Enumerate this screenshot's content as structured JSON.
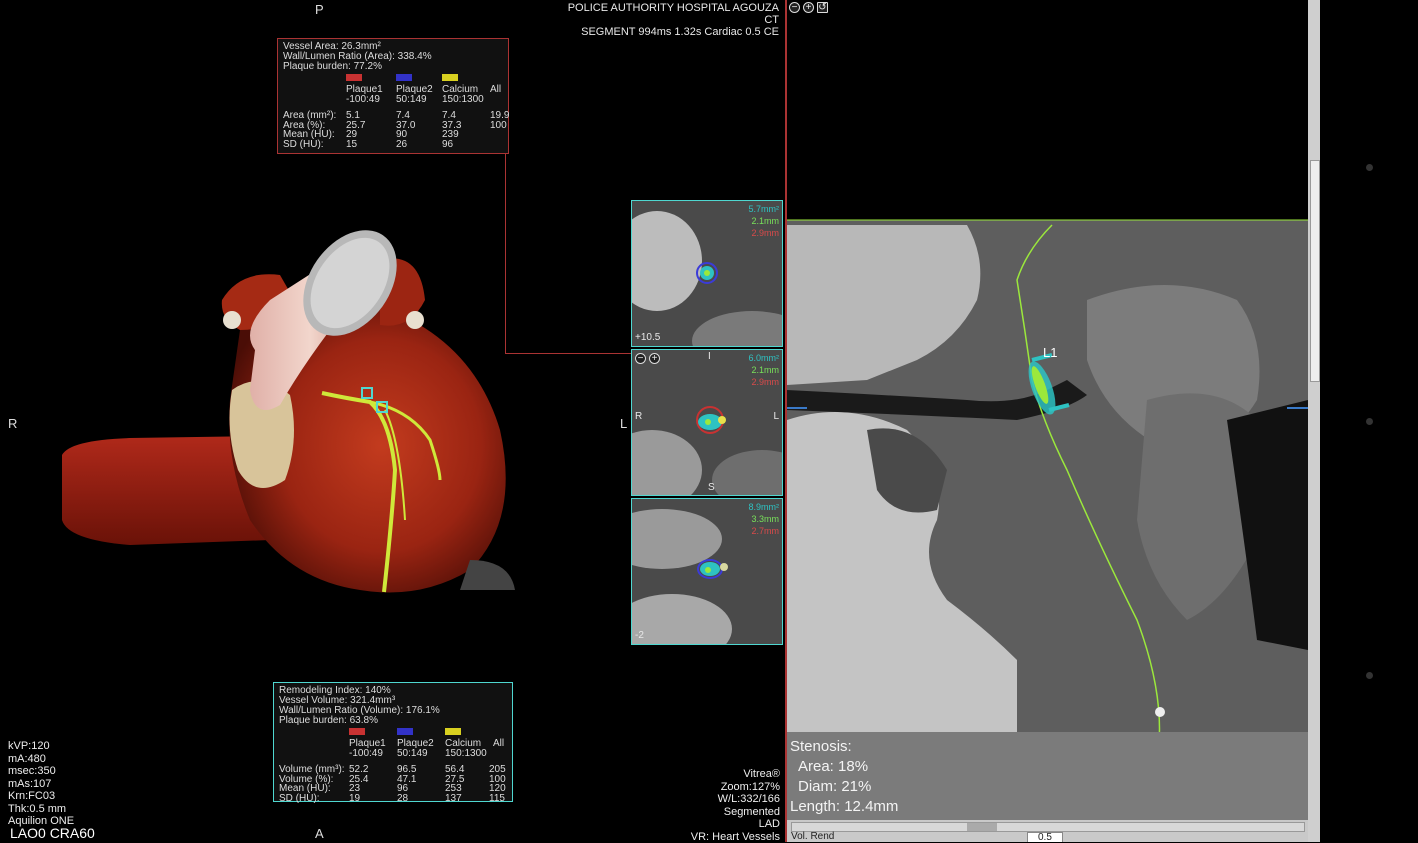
{
  "header": {
    "hospital": "POLICE AUTHORITY HOSPITAL AGOUZA",
    "modality": "CT",
    "segment": "SEGMENT 994ms 1.32s Cardiac 0.5 CE"
  },
  "orientation": {
    "top": "P",
    "bottom": "A",
    "left": "R",
    "right": "L"
  },
  "cross_section_labels": {
    "top_right": [
      "5.7mm²",
      "2.1mm",
      "2.9mm"
    ],
    "mid_right": [
      "6.0mm²",
      "2.1mm",
      "2.9mm"
    ],
    "bot_right": [
      "8.9mm²",
      "3.3mm",
      "2.7mm"
    ],
    "top_pos": "+10.5",
    "bot_pos": "-2",
    "mid_R": "R",
    "mid_L": "L",
    "mid_S": "S",
    "mid_I": "I"
  },
  "top_box": {
    "lines": [
      "Vessel Area: 26.3mm²",
      "Wall/Lumen Ratio (Area): 338.4%",
      "Plaque burden: 77.2%"
    ],
    "columns": [
      {
        "name": "Plaque1",
        "range": "-100:49",
        "color": "#c83232"
      },
      {
        "name": "Plaque2",
        "range": "50:149",
        "color": "#3232c8"
      },
      {
        "name": "Calcium",
        "range": "150:1300",
        "color": "#d8d020"
      },
      {
        "name": "All",
        "range": "",
        "color": ""
      }
    ],
    "rows": [
      {
        "label": "Area (mm²):",
        "values": [
          "5.1",
          "7.4",
          "7.4",
          "19.9"
        ]
      },
      {
        "label": "Area (%):",
        "values": [
          "25.7",
          "37.0",
          "37.3",
          "100"
        ]
      },
      {
        "label": "Mean (HU):",
        "values": [
          "29",
          "90",
          "239",
          ""
        ]
      },
      {
        "label": "SD (HU):",
        "values": [
          "15",
          "26",
          "96",
          ""
        ]
      }
    ]
  },
  "bottom_box": {
    "lines": [
      "Remodeling Index: 140%",
      "Vessel Volume: 321.4mm³",
      "Wall/Lumen Ratio (Volume): 176.1%",
      "Plaque burden: 63.8%"
    ],
    "columns": [
      {
        "name": "Plaque1",
        "range": "-100:49",
        "color": "#c83232"
      },
      {
        "name": "Plaque2",
        "range": "50:149",
        "color": "#3232c8"
      },
      {
        "name": "Calcium",
        "range": "150:1300",
        "color": "#d8d020"
      },
      {
        "name": "All",
        "range": "",
        "color": ""
      }
    ],
    "rows": [
      {
        "label": "Volume (mm³):",
        "values": [
          "52.2",
          "96.5",
          "56.4",
          "205"
        ]
      },
      {
        "label": "Volume (%):",
        "values": [
          "25.4",
          "47.1",
          "27.5",
          "100"
        ]
      },
      {
        "label": "Mean (HU):",
        "values": [
          "23",
          "96",
          "253",
          "120"
        ]
      },
      {
        "label": "SD (HU):",
        "values": [
          "19",
          "28",
          "137",
          "115"
        ]
      }
    ]
  },
  "scan_params": [
    "kVP:120",
    "mA:480",
    "msec:350",
    "mAs:107",
    "Krn:FC03",
    "Thk:0.5 mm",
    "Aquilion ONE"
  ],
  "view_angle": "LAO0 CRA60",
  "bottom_right_info": [
    "Vitrea®",
    "Zoom:127%",
    "W/L:332/166",
    "Segmented",
    "LAD",
    "VR: Heart Vessels"
  ],
  "curved_view": {
    "lesion_label": "L1",
    "stenosis_title": "Stenosis:",
    "area": "Area: 18%",
    "diam": "Diam: 21%",
    "length": "Length: 12.4mm"
  },
  "bottom_bar": {
    "mode": "Vol. Rend",
    "thickness": "0.5"
  },
  "colors": {
    "cyan": "#4fd7d0",
    "red_sep": "#a33333",
    "centerline": "#9be83c"
  }
}
